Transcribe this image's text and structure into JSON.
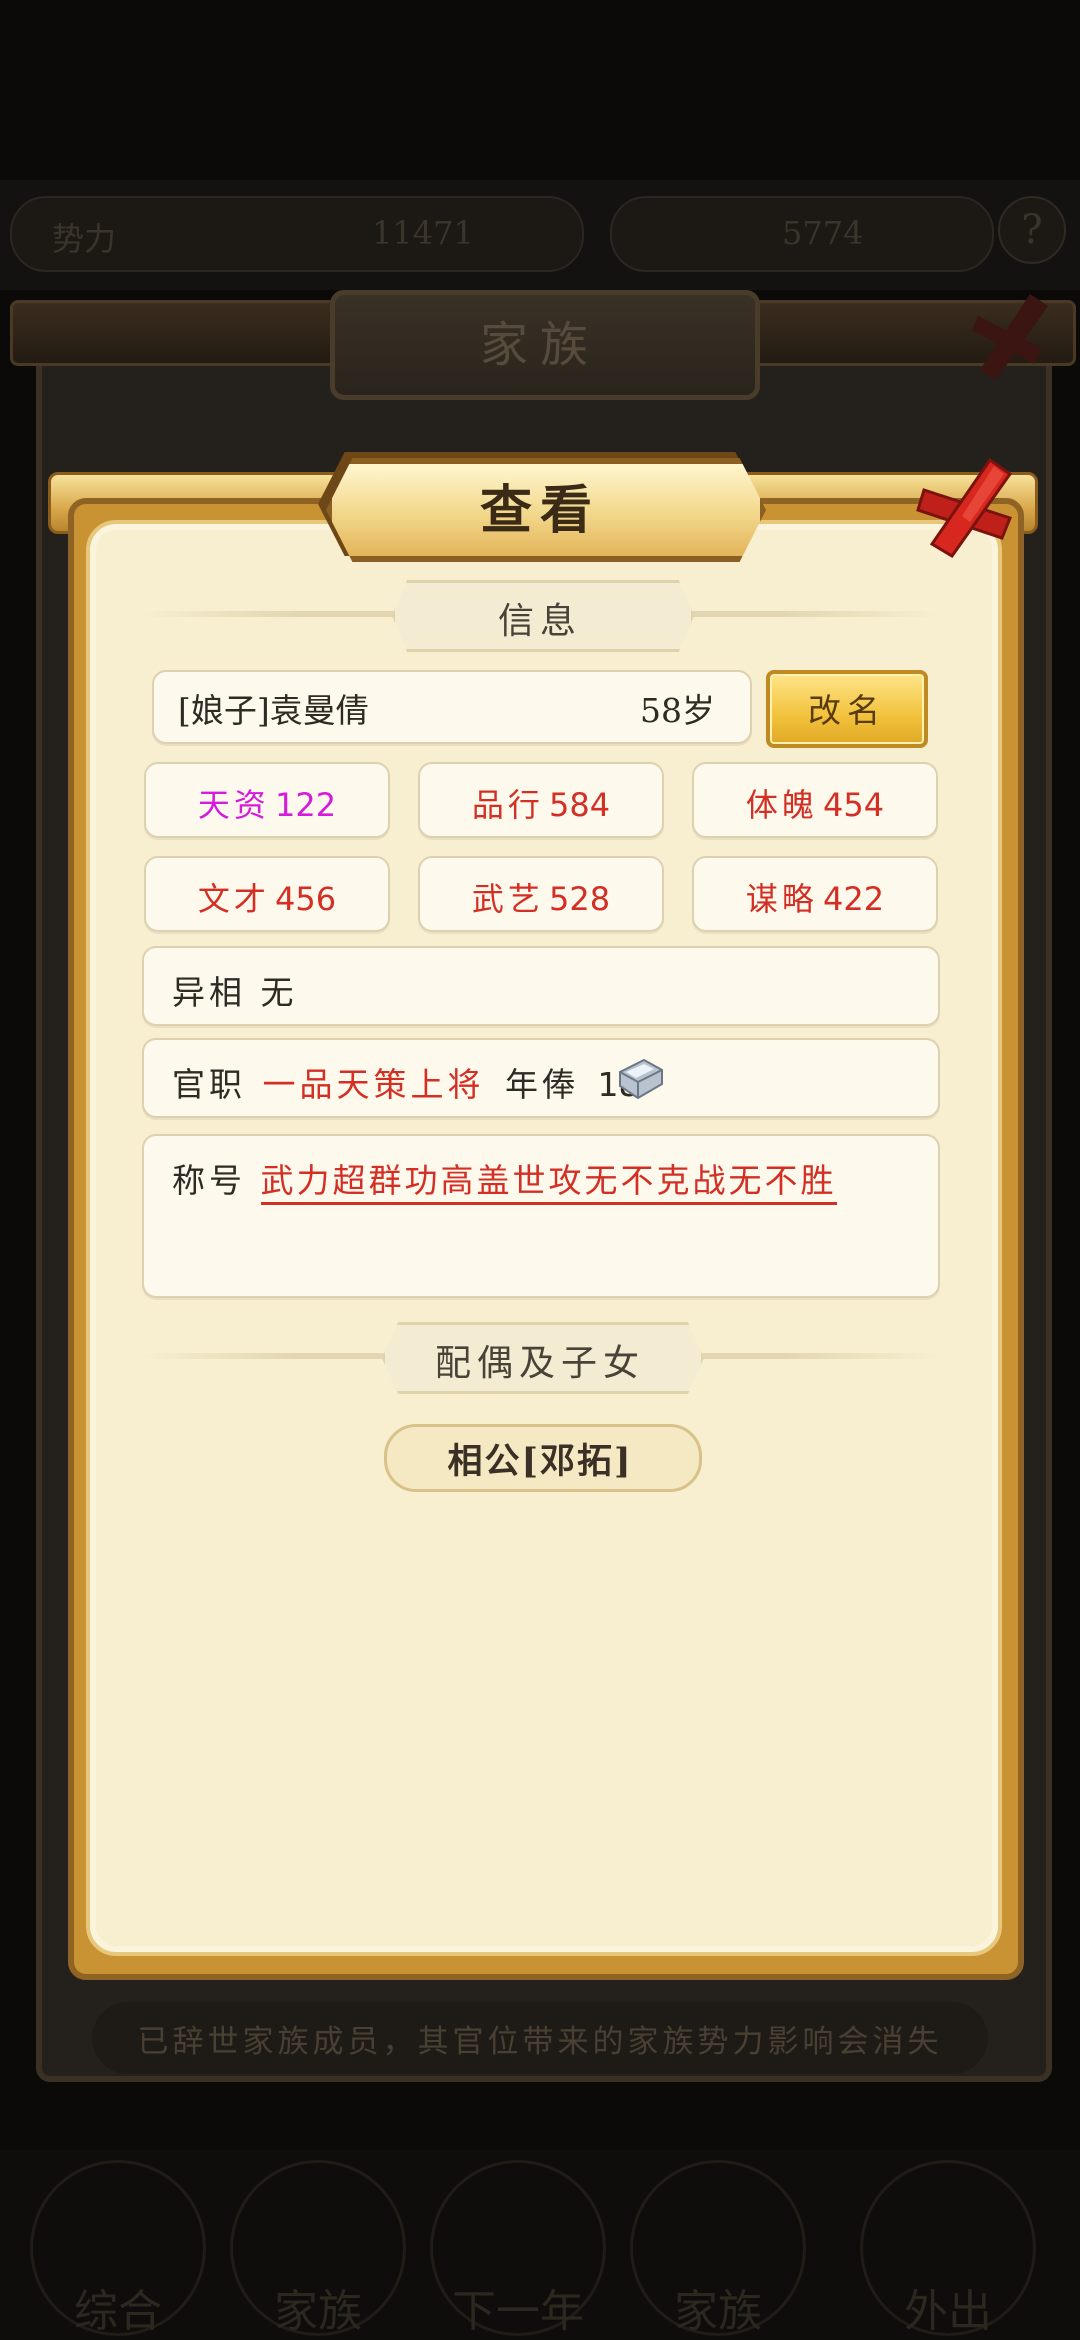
{
  "background": {
    "top_left_text": "势力",
    "top_left_value": "11471",
    "top_right_value": "5774",
    "panel_title": "家族",
    "notice": "已辞世家族成员，其官位带来的家族势力影响会消失",
    "nav_labels": [
      "综合",
      "家族",
      "下一年",
      "家族",
      "外出"
    ]
  },
  "modal": {
    "title": "查看",
    "info_section": "信息",
    "member_name": "[娘子]袁曼倩",
    "age": "58岁",
    "rename_button": "改名",
    "stats": [
      {
        "label": "天资",
        "value": "122",
        "color": "#d51bdc"
      },
      {
        "label": "品行",
        "value": "584",
        "color": "#d42f24"
      },
      {
        "label": "体魄",
        "value": "454",
        "color": "#d42f24"
      },
      {
        "label": "文才",
        "value": "456",
        "color": "#d42f24"
      },
      {
        "label": "武艺",
        "value": "528",
        "color": "#d42f24"
      },
      {
        "label": "谋略",
        "value": "422",
        "color": "#d42f24"
      }
    ],
    "trait_label": "异相",
    "trait_value": "无",
    "office_label": "官职",
    "office_value": "一品天策上将",
    "salary_label": "年俸",
    "salary_value": "18",
    "honor_label": "称号",
    "honor_value": "武力超群功高盖世攻无不克战无不胜",
    "family_section": "配偶及子女",
    "spouse_tab": "相公[邓拓]"
  },
  "colors": {
    "accent_red": "#d42f24",
    "accent_purple": "#d51bdc",
    "panel_bg": "#f7efcf",
    "gold": "#f2c23c"
  },
  "icons": [
    "close-icon",
    "silver-ingot-icon",
    "help-icon"
  ]
}
